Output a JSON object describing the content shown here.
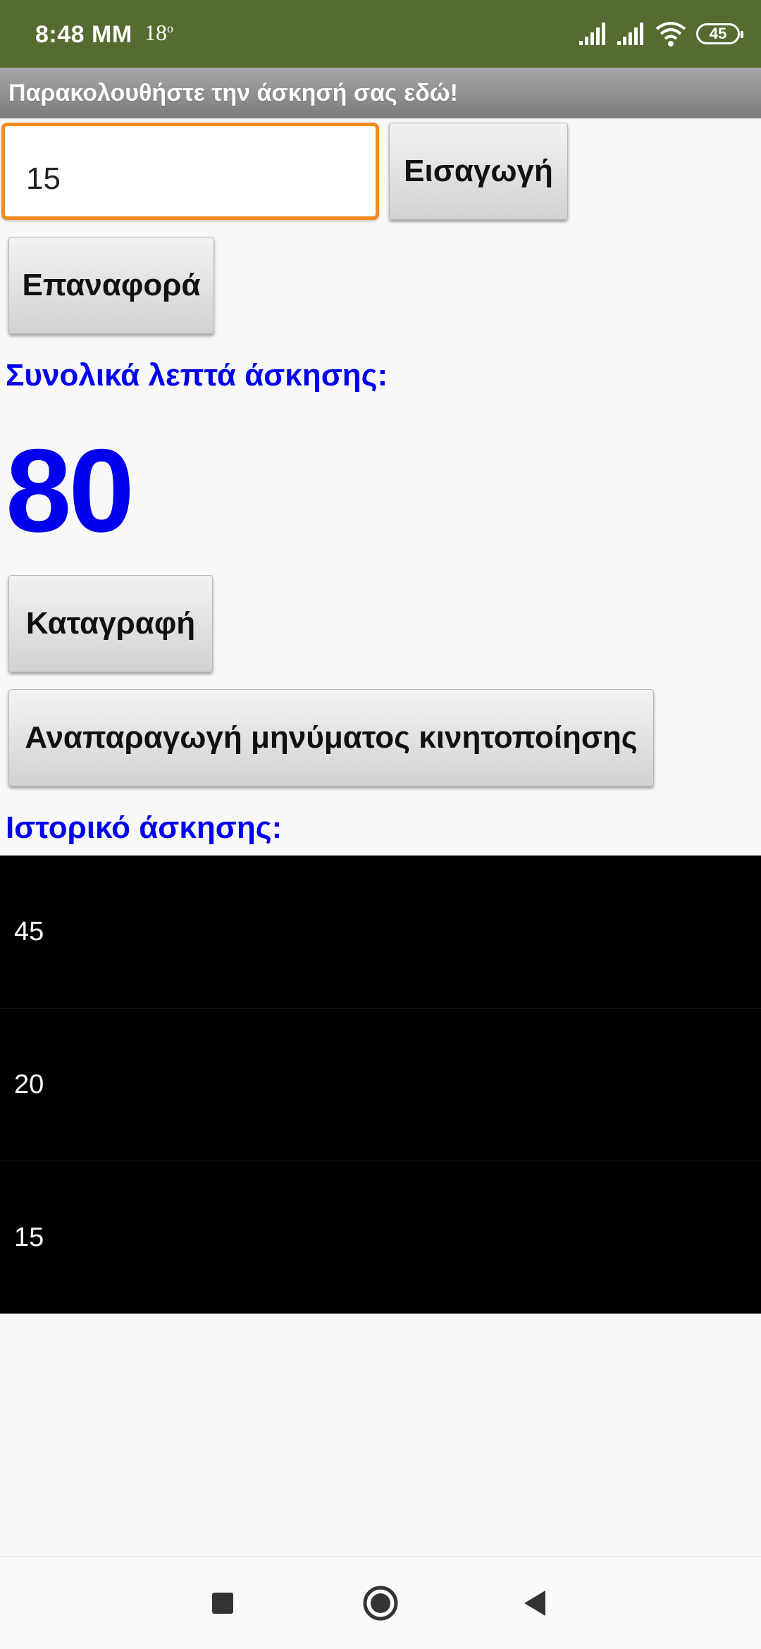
{
  "status_bar": {
    "time": "8:48 MM",
    "temperature": "18",
    "temperature_unit": "o",
    "battery_level": "45"
  },
  "app": {
    "title": "Παρακολουθήστε την άσκησή σας εδώ!"
  },
  "input": {
    "value": "15",
    "placeholder": ""
  },
  "buttons": {
    "enter": "Εισαγωγή",
    "reset": "Επαναφορά",
    "record": "Καταγραφή",
    "motivation": "Αναπαραγωγή μηνύματος κινητοποίησης"
  },
  "total": {
    "label": "Συνολικά λεπτά άσκησης:",
    "value": "80"
  },
  "history": {
    "label": "Ιστορικό άσκησης:",
    "items": [
      "45",
      "20",
      "15"
    ]
  },
  "colors": {
    "status_bar": "#556b2f",
    "accent_blue": "#0000ee",
    "input_focus": "#f28a1c",
    "list_background": "#000000"
  },
  "icons": {
    "signal": "signal-icon",
    "wifi": "wifi-icon",
    "battery": "battery-icon",
    "recent": "recent-apps-icon",
    "home": "home-icon",
    "back": "back-icon"
  }
}
